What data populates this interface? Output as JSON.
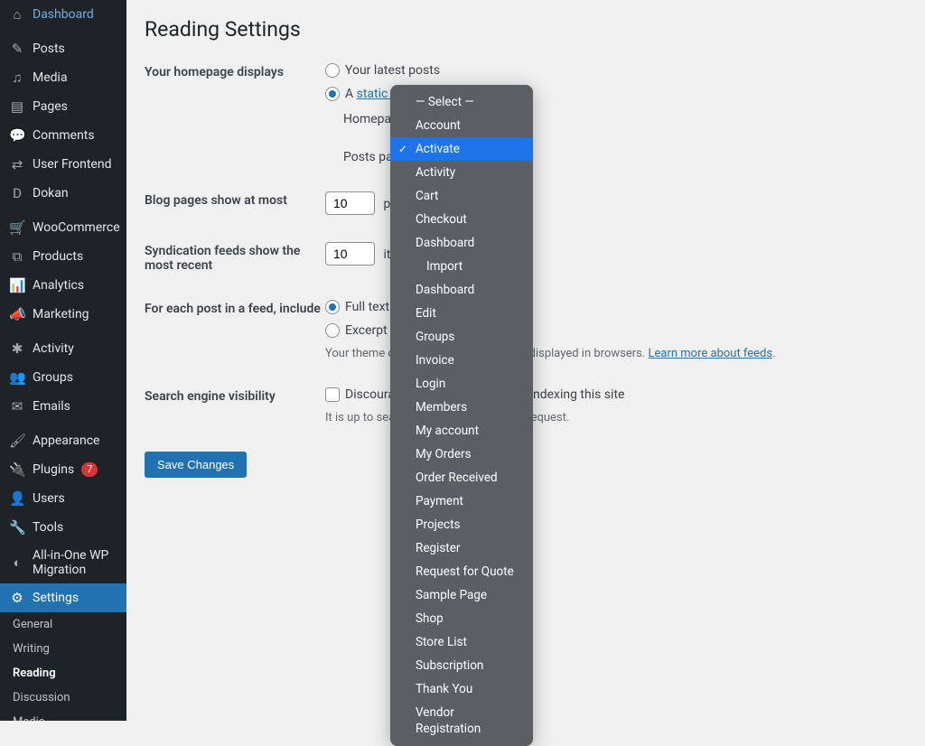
{
  "sidebar": {
    "items": [
      {
        "icon": "⌂",
        "label": "Dashboard"
      },
      {
        "icon": "✎",
        "label": "Posts"
      },
      {
        "icon": "♫",
        "label": "Media"
      },
      {
        "icon": "▤",
        "label": "Pages"
      },
      {
        "icon": "💬",
        "label": "Comments"
      },
      {
        "icon": "⇄",
        "label": "User Frontend"
      },
      {
        "icon": "D",
        "label": "Dokan"
      },
      {
        "icon": "🛒",
        "label": "WooCommerce"
      },
      {
        "icon": "⧉",
        "label": "Products"
      },
      {
        "icon": "📊",
        "label": "Analytics"
      },
      {
        "icon": "📣",
        "label": "Marketing"
      },
      {
        "icon": "✱",
        "label": "Activity"
      },
      {
        "icon": "👥",
        "label": "Groups"
      },
      {
        "icon": "✉",
        "label": "Emails"
      },
      {
        "icon": "🖌",
        "label": "Appearance"
      },
      {
        "icon": "🔌",
        "label": "Plugins",
        "badge": "7"
      },
      {
        "icon": "👤",
        "label": "Users"
      },
      {
        "icon": "🔧",
        "label": "Tools"
      },
      {
        "icon": "◐",
        "label": "All-in-One WP Migration"
      },
      {
        "icon": "⚙",
        "label": "Settings",
        "active": true
      }
    ],
    "subs": [
      {
        "label": "General"
      },
      {
        "label": "Writing"
      },
      {
        "label": "Reading",
        "current": true
      },
      {
        "label": "Discussion"
      },
      {
        "label": "Media"
      }
    ]
  },
  "page": {
    "title": "Reading Settings",
    "homepage_label": "Your homepage displays",
    "opt_latest": "Your latest posts",
    "opt_static_prefix": "A ",
    "opt_static_link": "static page",
    "home_sel": "Homepage:",
    "posts_sel": "Posts page:",
    "blog_label": "Blog pages show at most",
    "blog_value": "10",
    "blog_suffix": "posts",
    "synd_label": "Syndication feeds show the most recent",
    "synd_value": "10",
    "synd_suffix": "items",
    "feed_label": "For each post in a feed, include",
    "feed_full": "Full text",
    "feed_excerpt": "Excerpt",
    "feed_desc_a": "Your theme determines how content is displayed in browsers. ",
    "feed_desc_link": "Learn more about feeds",
    "feed_desc_b": ".",
    "search_label": "Search engine visibility",
    "search_check": "Discourage search engines from indexing this site",
    "search_desc": "It is up to search engines to honor this request.",
    "save": "Save Changes"
  },
  "dropdown": {
    "items": [
      {
        "label": "— Select —"
      },
      {
        "label": "Account"
      },
      {
        "label": "Activate",
        "selected": true
      },
      {
        "label": "Activity"
      },
      {
        "label": "Cart"
      },
      {
        "label": "Checkout"
      },
      {
        "label": "Dashboard"
      },
      {
        "label": "Import",
        "indent": true
      },
      {
        "label": "Dashboard"
      },
      {
        "label": "Edit"
      },
      {
        "label": "Groups"
      },
      {
        "label": "Invoice"
      },
      {
        "label": "Login"
      },
      {
        "label": "Members"
      },
      {
        "label": "My account"
      },
      {
        "label": "My Orders"
      },
      {
        "label": "Order Received"
      },
      {
        "label": "Payment"
      },
      {
        "label": "Projects"
      },
      {
        "label": "Register"
      },
      {
        "label": "Request for Quote"
      },
      {
        "label": "Sample Page"
      },
      {
        "label": "Shop"
      },
      {
        "label": "Store List"
      },
      {
        "label": "Subscription"
      },
      {
        "label": "Thank You"
      },
      {
        "label": "Vendor Registration"
      }
    ]
  }
}
